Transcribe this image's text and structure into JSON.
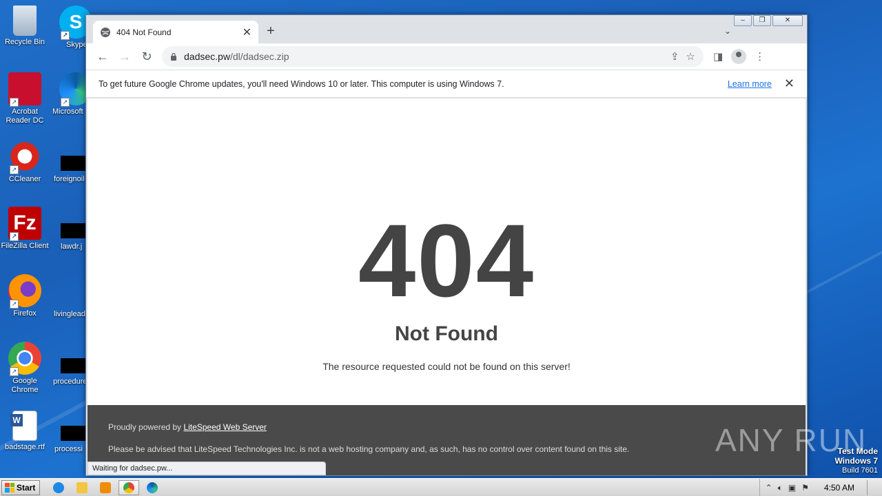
{
  "desktop": {
    "icons": [
      {
        "label": "Recycle Bin"
      },
      {
        "label": "Skype"
      },
      {
        "label": "Acrobat Reader DC"
      },
      {
        "label": "Microsoft"
      },
      {
        "label": "CCleaner"
      },
      {
        "label": "foreignoil"
      },
      {
        "label": "FileZilla Client"
      },
      {
        "label": "lawdr.j"
      },
      {
        "label": "Firefox"
      },
      {
        "label": "livinglead"
      },
      {
        "label": "Google Chrome"
      },
      {
        "label": "procedure"
      },
      {
        "label": "badstage.rtf"
      },
      {
        "label": "processi"
      }
    ]
  },
  "browser": {
    "tab_title": "404 Not Found",
    "url_host": "dadsec.pw",
    "url_path": "/dl/dadsec.zip",
    "infobar_message": "To get future Google Chrome updates, you'll need Windows 10 or later. This computer is using Windows 7.",
    "infobar_link": "Learn more",
    "status_text": "Waiting for dadsec.pw..."
  },
  "page": {
    "code": "404",
    "heading": "Not Found",
    "message": "The resource requested could not be found on this server!",
    "footer_prefix": "Proudly powered by ",
    "footer_link": "LiteSpeed Web Server",
    "footer_notice": "Please be advised that LiteSpeed Technologies Inc. is not a web hosting company and, as such, has no control over content found on this site."
  },
  "watermark": "ANY RUN",
  "testmode": {
    "line1": "Test Mode",
    "line2": "Windows 7",
    "build": "Build 7601"
  },
  "taskbar": {
    "start_label": "Start",
    "clock": "4:50 AM"
  }
}
